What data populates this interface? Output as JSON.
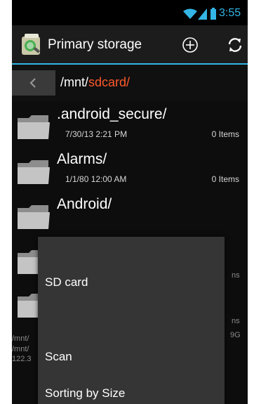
{
  "status_bar": {
    "time": "3:55",
    "icons": [
      "wifi-icon",
      "signal-icon",
      "battery-icon"
    ],
    "accent_color": "#33b5e5"
  },
  "action_bar": {
    "title": "Primary storage",
    "icons": [
      "app-icon",
      "add-icon",
      "refresh-icon"
    ]
  },
  "path_bar": {
    "prefix": "/mnt/",
    "current": "sdcard/",
    "current_color": "#ff5a2a"
  },
  "files": [
    {
      "name": ".android_secure/",
      "date": "7/30/13 2:21 PM",
      "count": "0 Items"
    },
    {
      "name": "Alarms/",
      "date": "1/1/80 12:00 AM",
      "count": "0 Items"
    },
    {
      "name": "Android/",
      "date": "",
      "count": ""
    }
  ],
  "partial_text": {
    "row4_count": "ns",
    "row5_count": "ns",
    "row5_size": "9G",
    "left_line1": "/mnt/",
    "left_line2": "/mnt/",
    "left_line3": "122.3"
  },
  "menu": {
    "items": [
      {
        "label": ""
      },
      {
        "label": "SD card"
      },
      {
        "label": ""
      },
      {
        "label": "Scan"
      },
      {
        "label": "Sorting by Size"
      }
    ]
  }
}
